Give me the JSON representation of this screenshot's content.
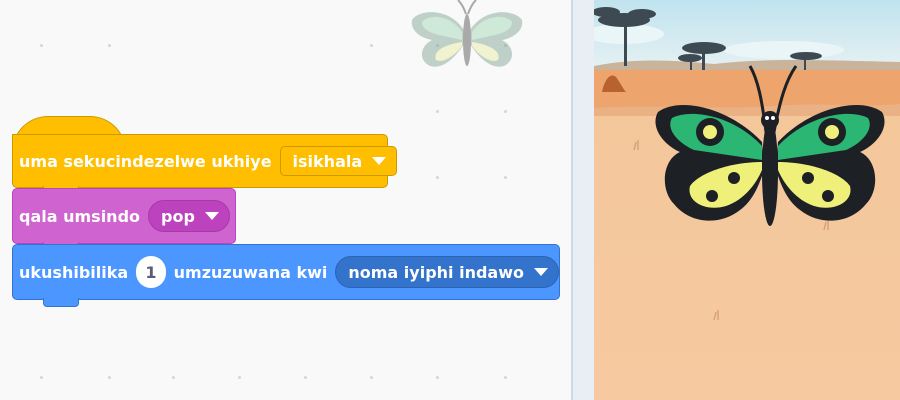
{
  "workspace": {
    "event_block": {
      "label": "uma sekucindezelwe ukhiye",
      "key_value": "isikhala"
    },
    "sound_block": {
      "label": "qala umsindo",
      "sound_value": "pop"
    },
    "motion_block": {
      "label_before": "ukushibilika",
      "seconds_value": "1",
      "label_after": "umzuzuwana kwi",
      "target_value": "noma iyiphi indawo"
    }
  },
  "colors": {
    "events": "#ffbf00",
    "sound": "#cf63cf",
    "motion": "#4c97ff"
  },
  "stage": {
    "backdrop": "savanna",
    "sprite": "butterfly"
  }
}
